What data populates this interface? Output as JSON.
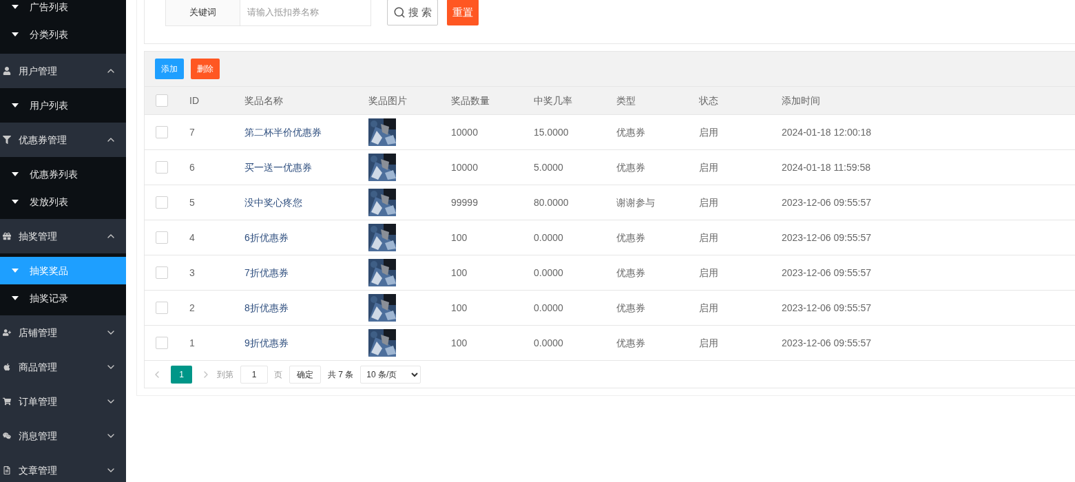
{
  "sidebar": {
    "top_children": [
      {
        "label": "广告列表",
        "selected": false
      },
      {
        "label": "分类列表",
        "selected": false
      }
    ],
    "items": [
      {
        "label": "用户管理",
        "expanded": true,
        "children": [
          {
            "label": "用户列表",
            "selected": false
          }
        ]
      },
      {
        "label": "优惠券管理",
        "expanded": true,
        "children": [
          {
            "label": "优惠券列表",
            "selected": false
          },
          {
            "label": "发放列表",
            "selected": false
          }
        ]
      },
      {
        "label": "抽奖管理",
        "expanded": true,
        "children": [
          {
            "label": "抽奖奖品",
            "selected": true
          },
          {
            "label": "抽奖记录",
            "selected": false
          }
        ]
      },
      {
        "label": "店铺管理",
        "expanded": false
      },
      {
        "label": "商品管理",
        "expanded": false
      },
      {
        "label": "订单管理",
        "expanded": false
      },
      {
        "label": "消息管理",
        "expanded": false
      },
      {
        "label": "文章管理",
        "expanded": false
      }
    ]
  },
  "search": {
    "label": "关键词",
    "placeholder": "请输入抵扣券名称",
    "search_button": "搜 索",
    "reset_button": "重置"
  },
  "toolbar": {
    "add_button": "添加",
    "delete_button": "删除"
  },
  "table": {
    "all_checked": false,
    "columns": [
      "ID",
      "奖品名称",
      "奖品图片",
      "奖品数量",
      "中奖几率",
      "类型",
      "状态",
      "添加时间"
    ],
    "rows": [
      {
        "checked": false,
        "id": "7",
        "name": "第二杯半价优惠券",
        "quantity": "10000",
        "rate": "15.0000",
        "type": "优惠券",
        "status": "启用",
        "added": "2024-01-18 12:00:18"
      },
      {
        "checked": false,
        "id": "6",
        "name": "买一送一优惠券",
        "quantity": "10000",
        "rate": "5.0000",
        "type": "优惠券",
        "status": "启用",
        "added": "2024-01-18 11:59:58"
      },
      {
        "checked": false,
        "id": "5",
        "name": "没中奖心疼您",
        "quantity": "99999",
        "rate": "80.0000",
        "type": "谢谢参与",
        "status": "启用",
        "added": "2023-12-06 09:55:57"
      },
      {
        "checked": false,
        "id": "4",
        "name": "6折优惠券",
        "quantity": "100",
        "rate": "0.0000",
        "type": "优惠券",
        "status": "启用",
        "added": "2023-12-06 09:55:57"
      },
      {
        "checked": false,
        "id": "3",
        "name": "7折优惠券",
        "quantity": "100",
        "rate": "0.0000",
        "type": "优惠券",
        "status": "启用",
        "added": "2023-12-06 09:55:57"
      },
      {
        "checked": false,
        "id": "2",
        "name": "8折优惠券",
        "quantity": "100",
        "rate": "0.0000",
        "type": "优惠券",
        "status": "启用",
        "added": "2023-12-06 09:55:57"
      },
      {
        "checked": false,
        "id": "1",
        "name": "9折优惠券",
        "quantity": "100",
        "rate": "0.0000",
        "type": "优惠券",
        "status": "启用",
        "added": "2023-12-06 09:55:57"
      }
    ]
  },
  "pagination": {
    "pages": [
      {
        "label": "1",
        "selected": true
      }
    ],
    "goto_label": "到第",
    "goto_value": "1",
    "page_unit": "页",
    "confirm_button": "确定",
    "total": "共 7 条",
    "page_size": "10 条/页"
  }
}
